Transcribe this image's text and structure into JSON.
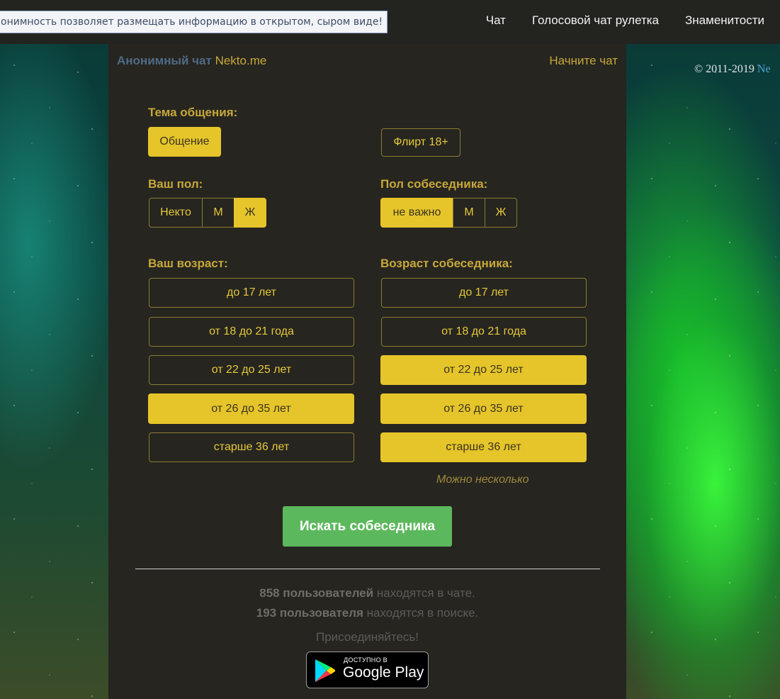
{
  "topbar": {
    "notice": "онимность позволяет размещать информацию в открытом, сыром виде!",
    "nav": [
      "Чат",
      "Голосовой чат рулетка",
      "Знаменитости"
    ]
  },
  "copyright": {
    "prefix": "© 2011-2019 ",
    "link": "Ne"
  },
  "header": {
    "brand_bold": "Анонимный чат",
    "brand_name": "Nekto.me",
    "start_chat": "Начните чат"
  },
  "topic": {
    "label": "Тема общения:",
    "options": [
      "Общение",
      "Флирт 18+"
    ],
    "selected": "Общение"
  },
  "your_gender": {
    "label": "Ваш пол:",
    "options": [
      "Некто",
      "М",
      "Ж"
    ],
    "selected": "Ж"
  },
  "partner_gender": {
    "label": "Пол собеседника:",
    "options": [
      "не важно",
      "М",
      "Ж"
    ],
    "selected": "не важно"
  },
  "your_age": {
    "label": "Ваш возраст:",
    "options": [
      "до 17 лет",
      "от 18 до 21 года",
      "от 22 до 25 лет",
      "от 26 до 35 лет",
      "старше 36 лет"
    ],
    "selected": [
      "от 26 до 35 лет"
    ]
  },
  "partner_age": {
    "label": "Возраст собеседника:",
    "options": [
      "до 17 лет",
      "от 18 до 21 года",
      "от 22 до 25 лет",
      "от 26 до 35 лет",
      "старше 36 лет"
    ],
    "selected": [
      "от 22 до 25 лет",
      "от 26 до 35 лет",
      "старше 36 лет"
    ],
    "hint": "Можно несколько"
  },
  "search_button": "Искать собеседника",
  "stats": {
    "in_chat_count": "858 пользователей",
    "in_chat_text": " находятся в чате.",
    "searching_count": "193 пользователя",
    "searching_text": " находятся в поиске.",
    "join": "Присоединяйтесь!"
  },
  "google_play": {
    "small": "ДОСТУПНО В",
    "big": "Google Play"
  },
  "colors": {
    "accent": "#e6c52a",
    "panel": "#262520",
    "search_button": "#5cb85c"
  }
}
